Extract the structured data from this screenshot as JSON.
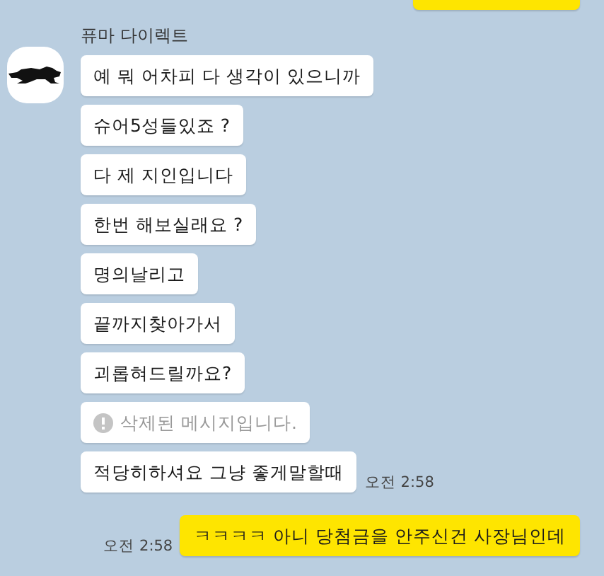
{
  "sender": {
    "name": "퓨마 다이렉트"
  },
  "messages": [
    {
      "kind": "text",
      "text": "예 뭐 어차피 다 생각이 있으니까"
    },
    {
      "kind": "text",
      "text": "슈어5성들있죠 ?"
    },
    {
      "kind": "text",
      "text": "다 제 지인입니다"
    },
    {
      "kind": "text",
      "text": "한번 해보실래요 ?"
    },
    {
      "kind": "text",
      "text": "명의날리고"
    },
    {
      "kind": "text",
      "text": "끝까지찾아가서"
    },
    {
      "kind": "text",
      "text": "괴롭혀드릴까요?"
    },
    {
      "kind": "deleted",
      "text": "삭제된 메시지입니다."
    },
    {
      "kind": "text",
      "text": "적당히하셔요 그냥 좋게말할때",
      "time": "오전 2:58"
    }
  ],
  "my_message": {
    "text": "ㅋㅋㅋㅋ 아니 당첨금을 안주신건 사장님인데",
    "time": "오전 2:58"
  }
}
